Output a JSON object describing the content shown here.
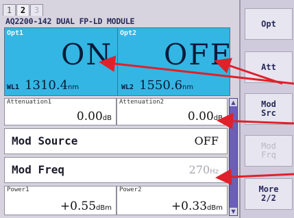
{
  "tabs": [
    "1",
    "2",
    "3"
  ],
  "active_tab": "2",
  "module_title": "AQ2200-142 DUAL FP-LD MODULE",
  "opt1": {
    "label": "Opt1",
    "state": "ON",
    "wl_label": "WL1",
    "wl_value": "1310.4",
    "wl_unit": "nm"
  },
  "opt2": {
    "label": "Opt2",
    "state": "OFF",
    "wl_label": "WL2",
    "wl_value": "1550.6",
    "wl_unit": "nm"
  },
  "attenuation1": {
    "label": "Attenuation1",
    "value": "0.00",
    "unit": "dB"
  },
  "attenuation2": {
    "label": "Attenuation2",
    "value": "0.00",
    "unit": "dB"
  },
  "mod_source": {
    "label": "Mod Source",
    "value": "OFF"
  },
  "mod_freq": {
    "label": "Mod Freq",
    "value": "270",
    "unit": "Hz"
  },
  "power1": {
    "label": "Power1",
    "value": "+0.55",
    "unit": "dBm"
  },
  "power2": {
    "label": "Power2",
    "value": "+0.33",
    "unit": "dBm"
  },
  "softkeys": {
    "opt": "Opt",
    "att": "Att",
    "mod_src_line1": "Mod",
    "mod_src_line2": "Src",
    "mod_frq_line1": "Mod",
    "mod_frq_line2": "Frq",
    "more_line1": "More",
    "more_line2": "2/2"
  },
  "colors": {
    "opt_panel": "#33b6e3",
    "annotation_arrow": "#e0202a",
    "scrollbar": "#6c5fb8"
  }
}
